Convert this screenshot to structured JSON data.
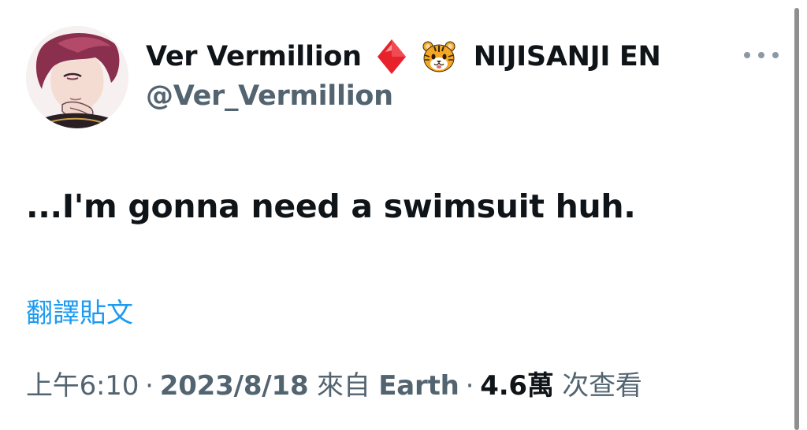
{
  "author": {
    "display_name": "Ver Vermillion",
    "org_name": "NIJISANJI EN",
    "handle": "@Ver_Vermillion",
    "badges": [
      "red-diamond-icon",
      "tiger-face-icon"
    ]
  },
  "tweet": {
    "text": "...I'm gonna need a swimsuit huh.",
    "translate_label": "翻譯貼文"
  },
  "meta": {
    "time": "上午6:10",
    "separator": "·",
    "date": "2023/8/18",
    "source_prefix": "來自",
    "source": "Earth",
    "views_count": "4.6萬",
    "views_label": "次查看"
  },
  "colors": {
    "text_primary": "#0f1419",
    "text_secondary": "#536471",
    "link": "#1d9bf0",
    "diamond": "#e8222b"
  }
}
